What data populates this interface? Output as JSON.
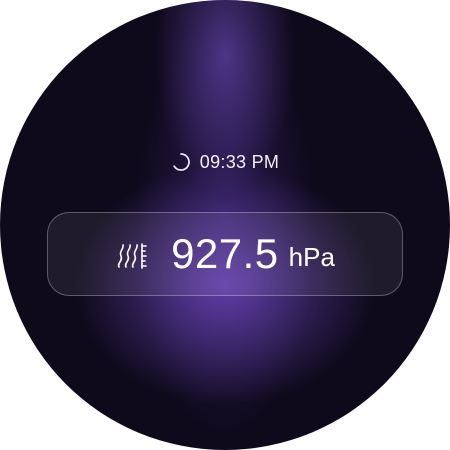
{
  "status": {
    "time": "09:33 PM",
    "loading_icon": "spinner-icon"
  },
  "reading": {
    "icon": "pressure-icon",
    "value": "927.5",
    "unit": "hPa"
  },
  "colors": {
    "background": "#0e0a1c",
    "accent": "#7e54d6",
    "text": "#ffffff"
  }
}
